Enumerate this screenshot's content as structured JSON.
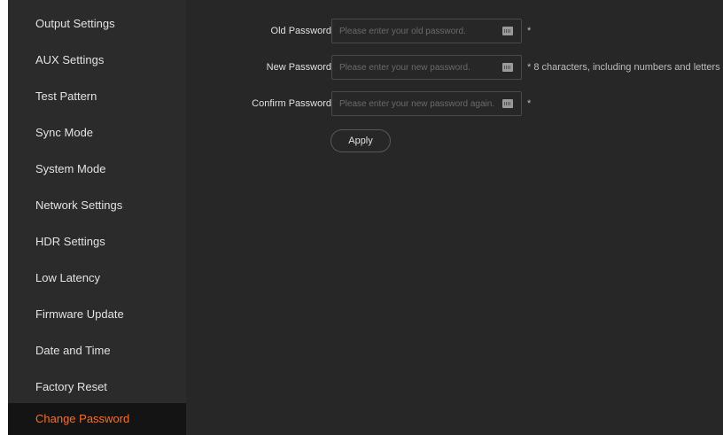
{
  "sidebar": {
    "items": [
      {
        "label": "Output Settings"
      },
      {
        "label": "AUX Settings"
      },
      {
        "label": "Test Pattern"
      },
      {
        "label": "Sync Mode"
      },
      {
        "label": "System Mode"
      },
      {
        "label": "Network Settings"
      },
      {
        "label": "HDR Settings"
      },
      {
        "label": "Low Latency"
      },
      {
        "label": "Firmware Update"
      },
      {
        "label": "Date and Time"
      },
      {
        "label": "Factory Reset"
      },
      {
        "label": "Change Password",
        "active": true
      }
    ]
  },
  "form": {
    "old_password": {
      "label": "Old Password",
      "placeholder": "Please enter your old password.",
      "value": "",
      "note": "*"
    },
    "new_password": {
      "label": "New Password",
      "placeholder": "Please enter your new password.",
      "value": "",
      "note": "* 8 characters, including numbers and letters"
    },
    "confirm_password": {
      "label": "Confirm Password",
      "placeholder": "Please enter your new password again.",
      "value": "",
      "note": "*"
    },
    "apply_label": "Apply"
  },
  "icons": {
    "field_icon": "keyboard-icon"
  },
  "colors": {
    "sidebar_bg": "#2b2b2b",
    "active_item_bg": "#141414",
    "accent": "#ff6d14",
    "main_bg": "#272727"
  }
}
